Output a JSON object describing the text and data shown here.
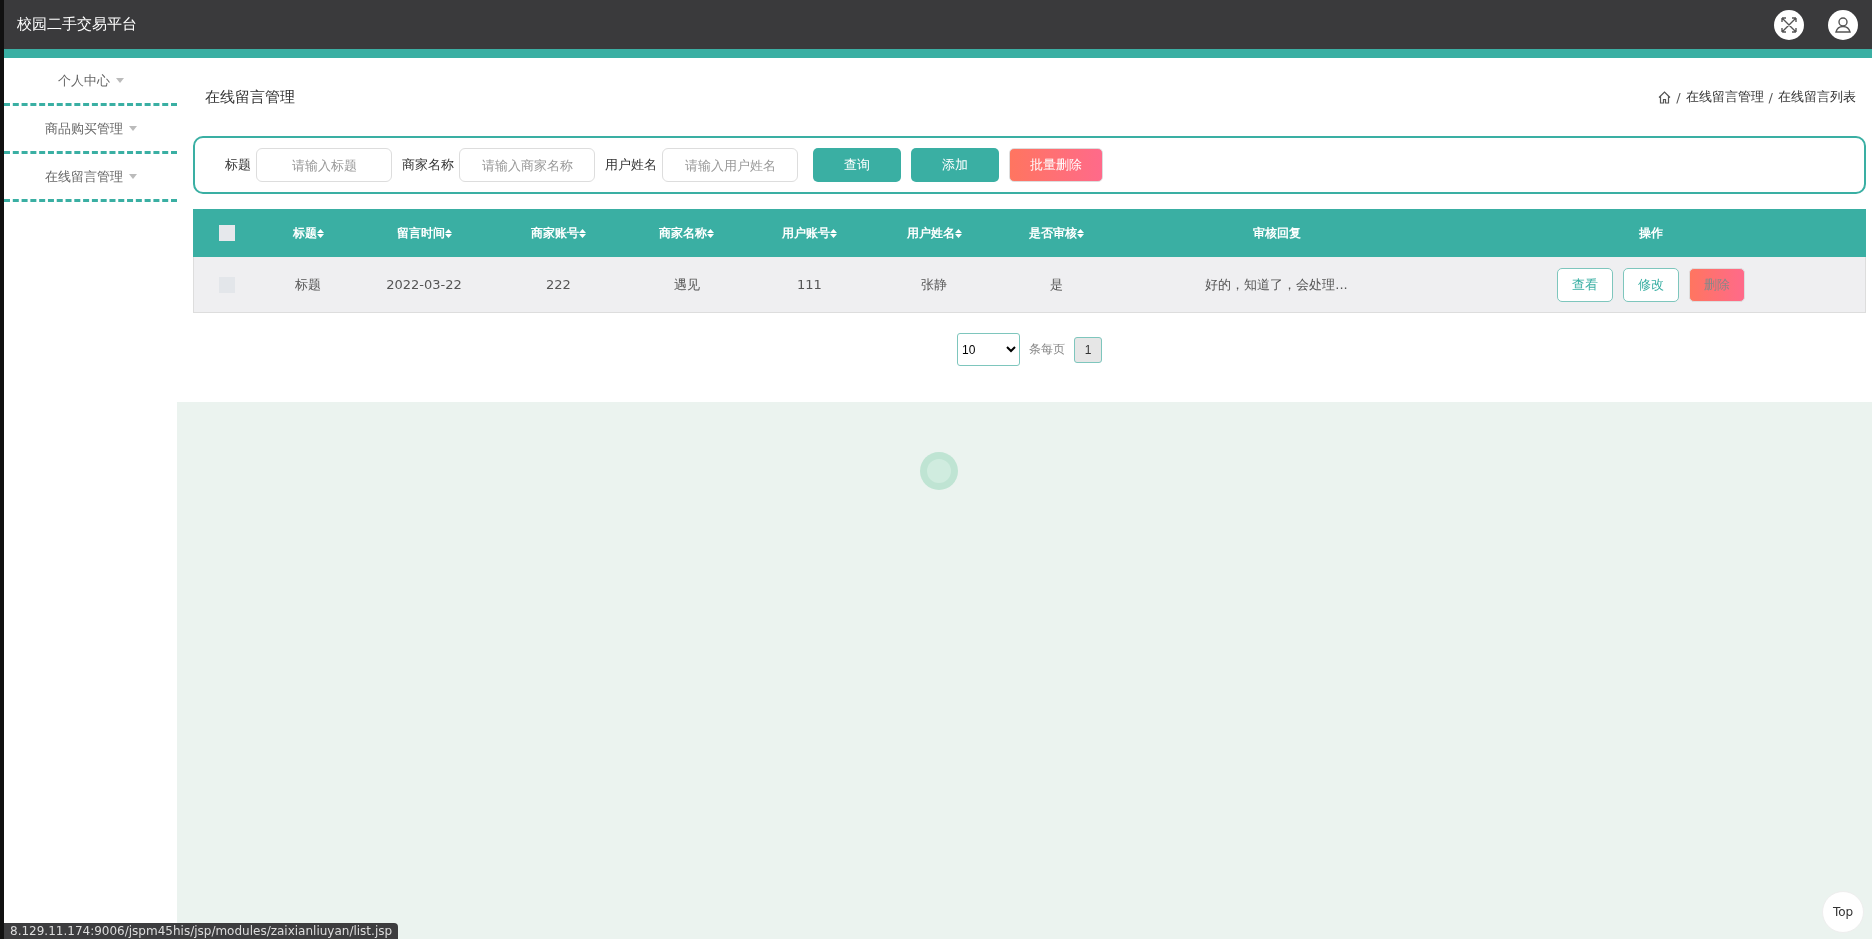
{
  "header": {
    "title": "校园二手交易平台"
  },
  "sidebar": {
    "items": [
      {
        "label": "个人中心"
      },
      {
        "label": "商品购买管理"
      },
      {
        "label": "在线留言管理"
      }
    ]
  },
  "page_title": "在线留言管理",
  "breadcrumb": [
    "在线留言管理",
    "在线留言列表"
  ],
  "breadcrumb_separator": "/",
  "search": {
    "fields": [
      {
        "label": "标题",
        "placeholder": "请输入标题"
      },
      {
        "label": "商家名称",
        "placeholder": "请输入商家名称"
      },
      {
        "label": "用户姓名",
        "placeholder": "请输入用户姓名"
      }
    ],
    "buttons": [
      {
        "label": "查询",
        "kind": "primary"
      },
      {
        "label": "添加",
        "kind": "primary"
      },
      {
        "label": "批量删除",
        "kind": "danger"
      }
    ]
  },
  "table": {
    "select_all": {
      "checked": false
    },
    "columns": [
      {
        "label": "标题",
        "sortable": true
      },
      {
        "label": "留言时间",
        "sortable": true
      },
      {
        "label": "商家账号",
        "sortable": true
      },
      {
        "label": "商家名称",
        "sortable": true
      },
      {
        "label": "用户账号",
        "sortable": true
      },
      {
        "label": "用户姓名",
        "sortable": true
      },
      {
        "label": "是否审核",
        "sortable": true
      },
      {
        "label": "审核回复",
        "sortable": false
      },
      {
        "label": "操作",
        "sortable": false
      }
    ],
    "rows": [
      {
        "checked": false,
        "cells": [
          "标题",
          "2022-03-22",
          "222",
          "遇见",
          "111",
          "张静",
          "是",
          "好的，知道了，会处理..."
        ],
        "actions": [
          {
            "label": "查看",
            "kind": "outline"
          },
          {
            "label": "修改",
            "kind": "outline"
          },
          {
            "label": "删除",
            "kind": "danger"
          }
        ]
      }
    ]
  },
  "pagination": {
    "page_size": "10",
    "page_size_label": "条每页",
    "pages": [
      {
        "label": "1",
        "selected": true
      }
    ]
  },
  "back_to_top": "Top",
  "status_url": "8.129.11.174:9006/jspm45his/jsp/modules/zaixianliuyan/list.jsp"
}
